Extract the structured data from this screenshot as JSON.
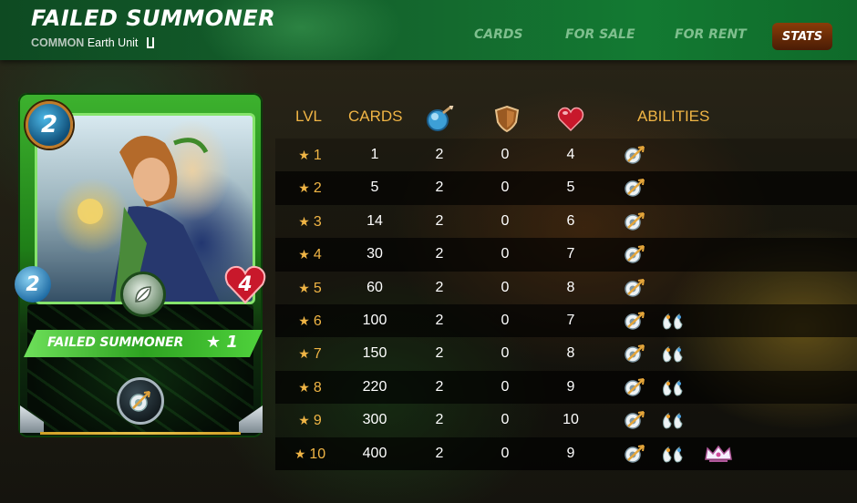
{
  "header": {
    "title": "FAILED SUMMONER",
    "rarity": "COMMON",
    "subtitle": "Earth Unit",
    "nav": [
      "CARDS",
      "FOR SALE",
      "FOR RENT"
    ],
    "active_tab": "STATS"
  },
  "card": {
    "mana": "2",
    "attack": "2",
    "health": "4",
    "name": "FAILED SUMMONER",
    "level_label": "★ 1",
    "element_icon": "leaf-icon",
    "ability_icon": "archery-ability-icon",
    "colors": {
      "frame": "#3db22e",
      "mana": "#1d6aa3",
      "health": "#c8182b"
    }
  },
  "table": {
    "headers": {
      "lvl": "LVL",
      "cards": "CARDS",
      "abilities": "ABILITIES"
    },
    "header_icons": [
      "attack-icon",
      "armor-icon",
      "health-icon"
    ],
    "rows": [
      {
        "lvl": "1",
        "cards": "1",
        "attack": "2",
        "armor": "0",
        "health": "4",
        "abilities": [
          "archery-ability-icon"
        ]
      },
      {
        "lvl": "2",
        "cards": "5",
        "attack": "2",
        "armor": "0",
        "health": "5",
        "abilities": [
          "archery-ability-icon"
        ]
      },
      {
        "lvl": "3",
        "cards": "14",
        "attack": "2",
        "armor": "0",
        "health": "6",
        "abilities": [
          "archery-ability-icon"
        ]
      },
      {
        "lvl": "4",
        "cards": "30",
        "attack": "2",
        "armor": "0",
        "health": "7",
        "abilities": [
          "archery-ability-icon"
        ]
      },
      {
        "lvl": "5",
        "cards": "60",
        "attack": "2",
        "armor": "0",
        "health": "8",
        "abilities": [
          "archery-ability-icon"
        ]
      },
      {
        "lvl": "6",
        "cards": "100",
        "attack": "2",
        "armor": "0",
        "health": "7",
        "abilities": [
          "archery-ability-icon",
          "tears-ability-icon"
        ]
      },
      {
        "lvl": "7",
        "cards": "150",
        "attack": "2",
        "armor": "0",
        "health": "8",
        "abilities": [
          "archery-ability-icon",
          "tears-ability-icon"
        ]
      },
      {
        "lvl": "8",
        "cards": "220",
        "attack": "2",
        "armor": "0",
        "health": "9",
        "abilities": [
          "archery-ability-icon",
          "tears-ability-icon"
        ]
      },
      {
        "lvl": "9",
        "cards": "300",
        "attack": "2",
        "armor": "0",
        "health": "10",
        "abilities": [
          "archery-ability-icon",
          "tears-ability-icon"
        ]
      },
      {
        "lvl": "10",
        "cards": "400",
        "attack": "2",
        "armor": "0",
        "health": "9",
        "abilities": [
          "archery-ability-icon",
          "tears-ability-icon",
          "crown-ability-icon"
        ]
      }
    ]
  }
}
